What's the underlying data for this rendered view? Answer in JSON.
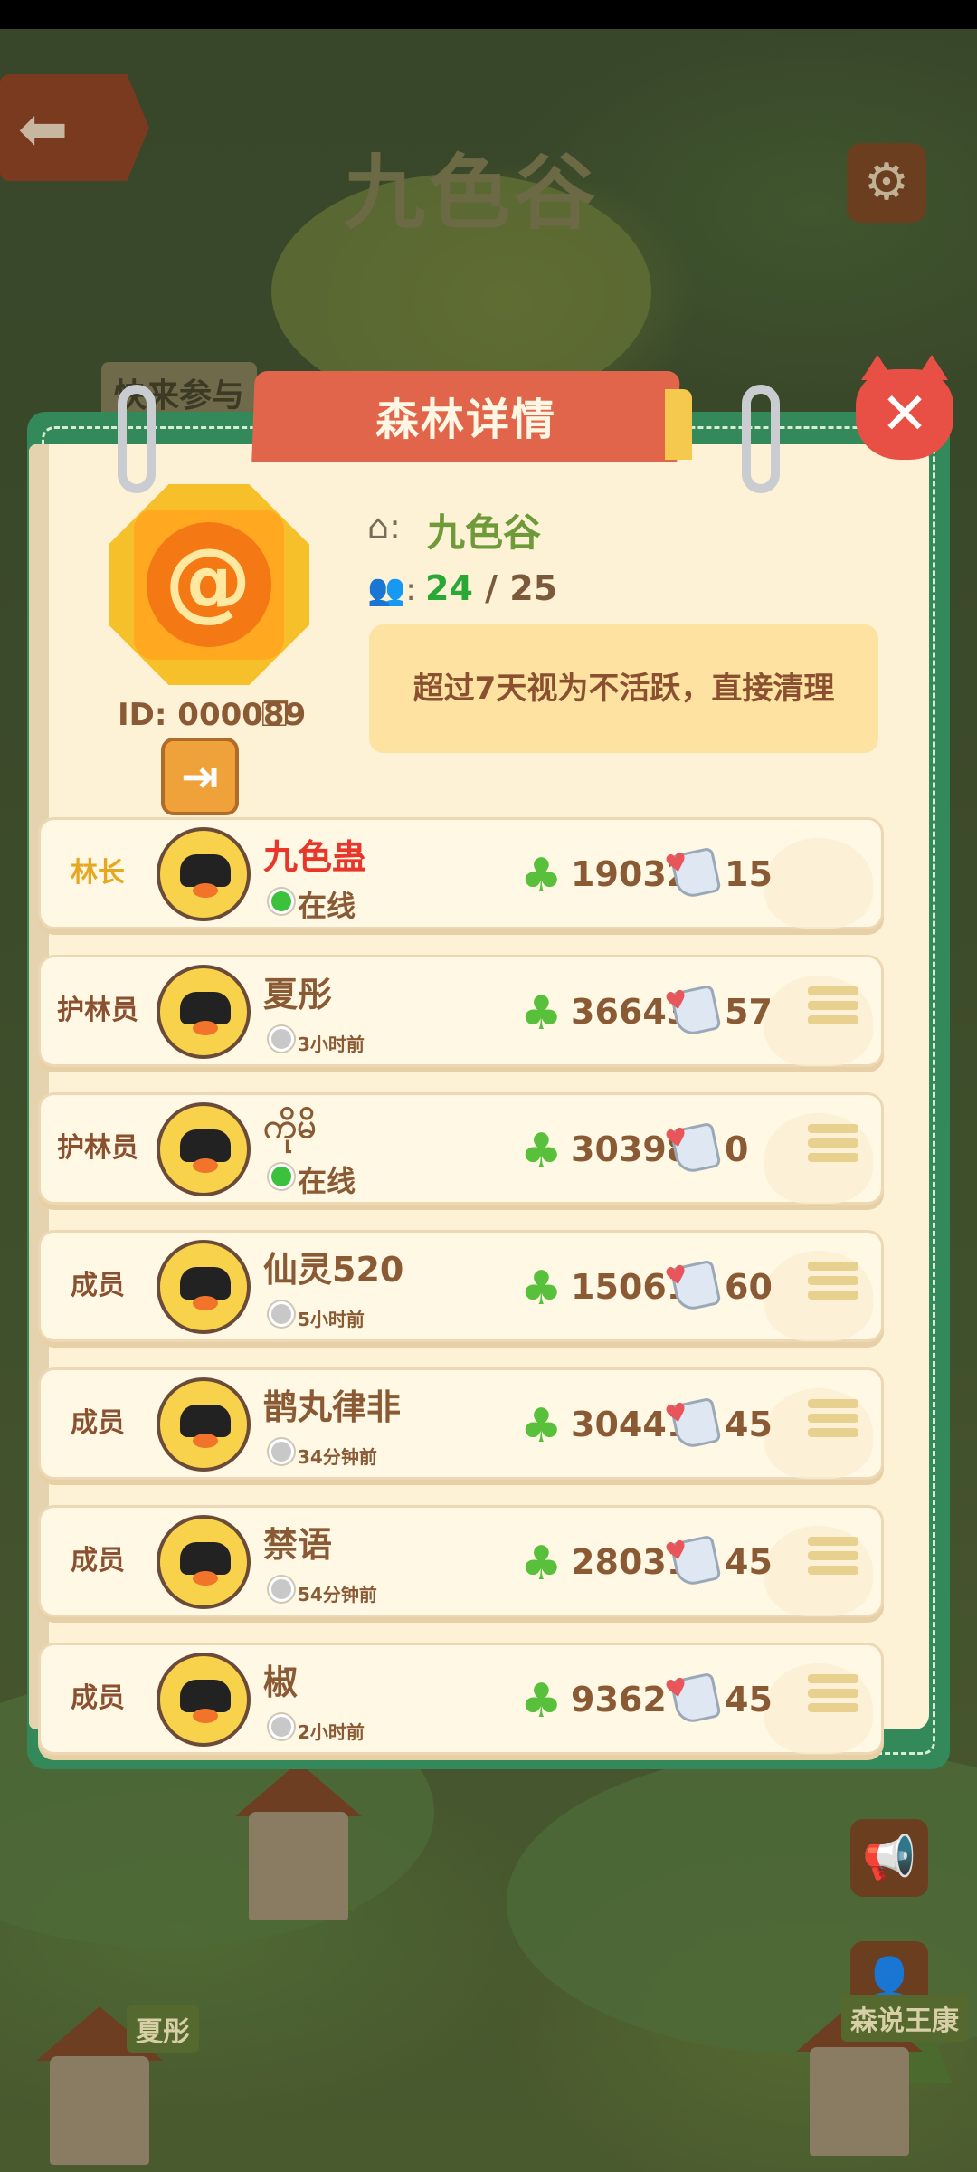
{
  "background": {
    "title": "九色谷",
    "invite_text": "快来参与",
    "tag_left": "夏彤",
    "tag_right": "森说王康"
  },
  "panel": {
    "title": "森林详情",
    "forest_name": "九色谷",
    "member_current": "24",
    "member_sep": " / ",
    "member_max": "25",
    "forest_id": "ID: 000089",
    "notice": "超过7天视为不活跃，直接清理"
  },
  "members": [
    {
      "role": "林长",
      "name": "九色蛊",
      "status": "在线",
      "online": true,
      "clover": "19032",
      "likes": "15"
    },
    {
      "role": "护林员",
      "name": "夏彤",
      "status": "3小时前",
      "online": false,
      "clover": "36643",
      "likes": "57"
    },
    {
      "role": "护林员",
      "name": "ကိုမိ",
      "status": "在线",
      "online": true,
      "clover": "30398",
      "likes": "0"
    },
    {
      "role": "成员",
      "name": "仙灵520",
      "status": "5小时前",
      "online": false,
      "clover": "15061",
      "likes": "60"
    },
    {
      "role": "成员",
      "name": "鹊丸律非",
      "status": "34分钟前",
      "online": false,
      "clover": "30441",
      "likes": "45"
    },
    {
      "role": "成员",
      "name": "禁语",
      "status": "54分钟前",
      "online": false,
      "clover": "28031",
      "likes": "45"
    },
    {
      "role": "成员",
      "name": "椒",
      "status": "2小时前",
      "online": false,
      "clover": "9362",
      "likes": "45"
    }
  ],
  "colors": {
    "panel_green": "#33895a",
    "header_red": "#e0654a",
    "leader_gold": "#e6a820",
    "leader_name_red": "#e8372a",
    "online_green": "#3cc13c"
  },
  "icons": [
    "back-arrow-icon",
    "gear-icon",
    "close-icon",
    "home-icon",
    "people-icon",
    "copy-icon",
    "exit-icon",
    "clover-icon",
    "heart-note-icon",
    "menu-icon"
  ]
}
